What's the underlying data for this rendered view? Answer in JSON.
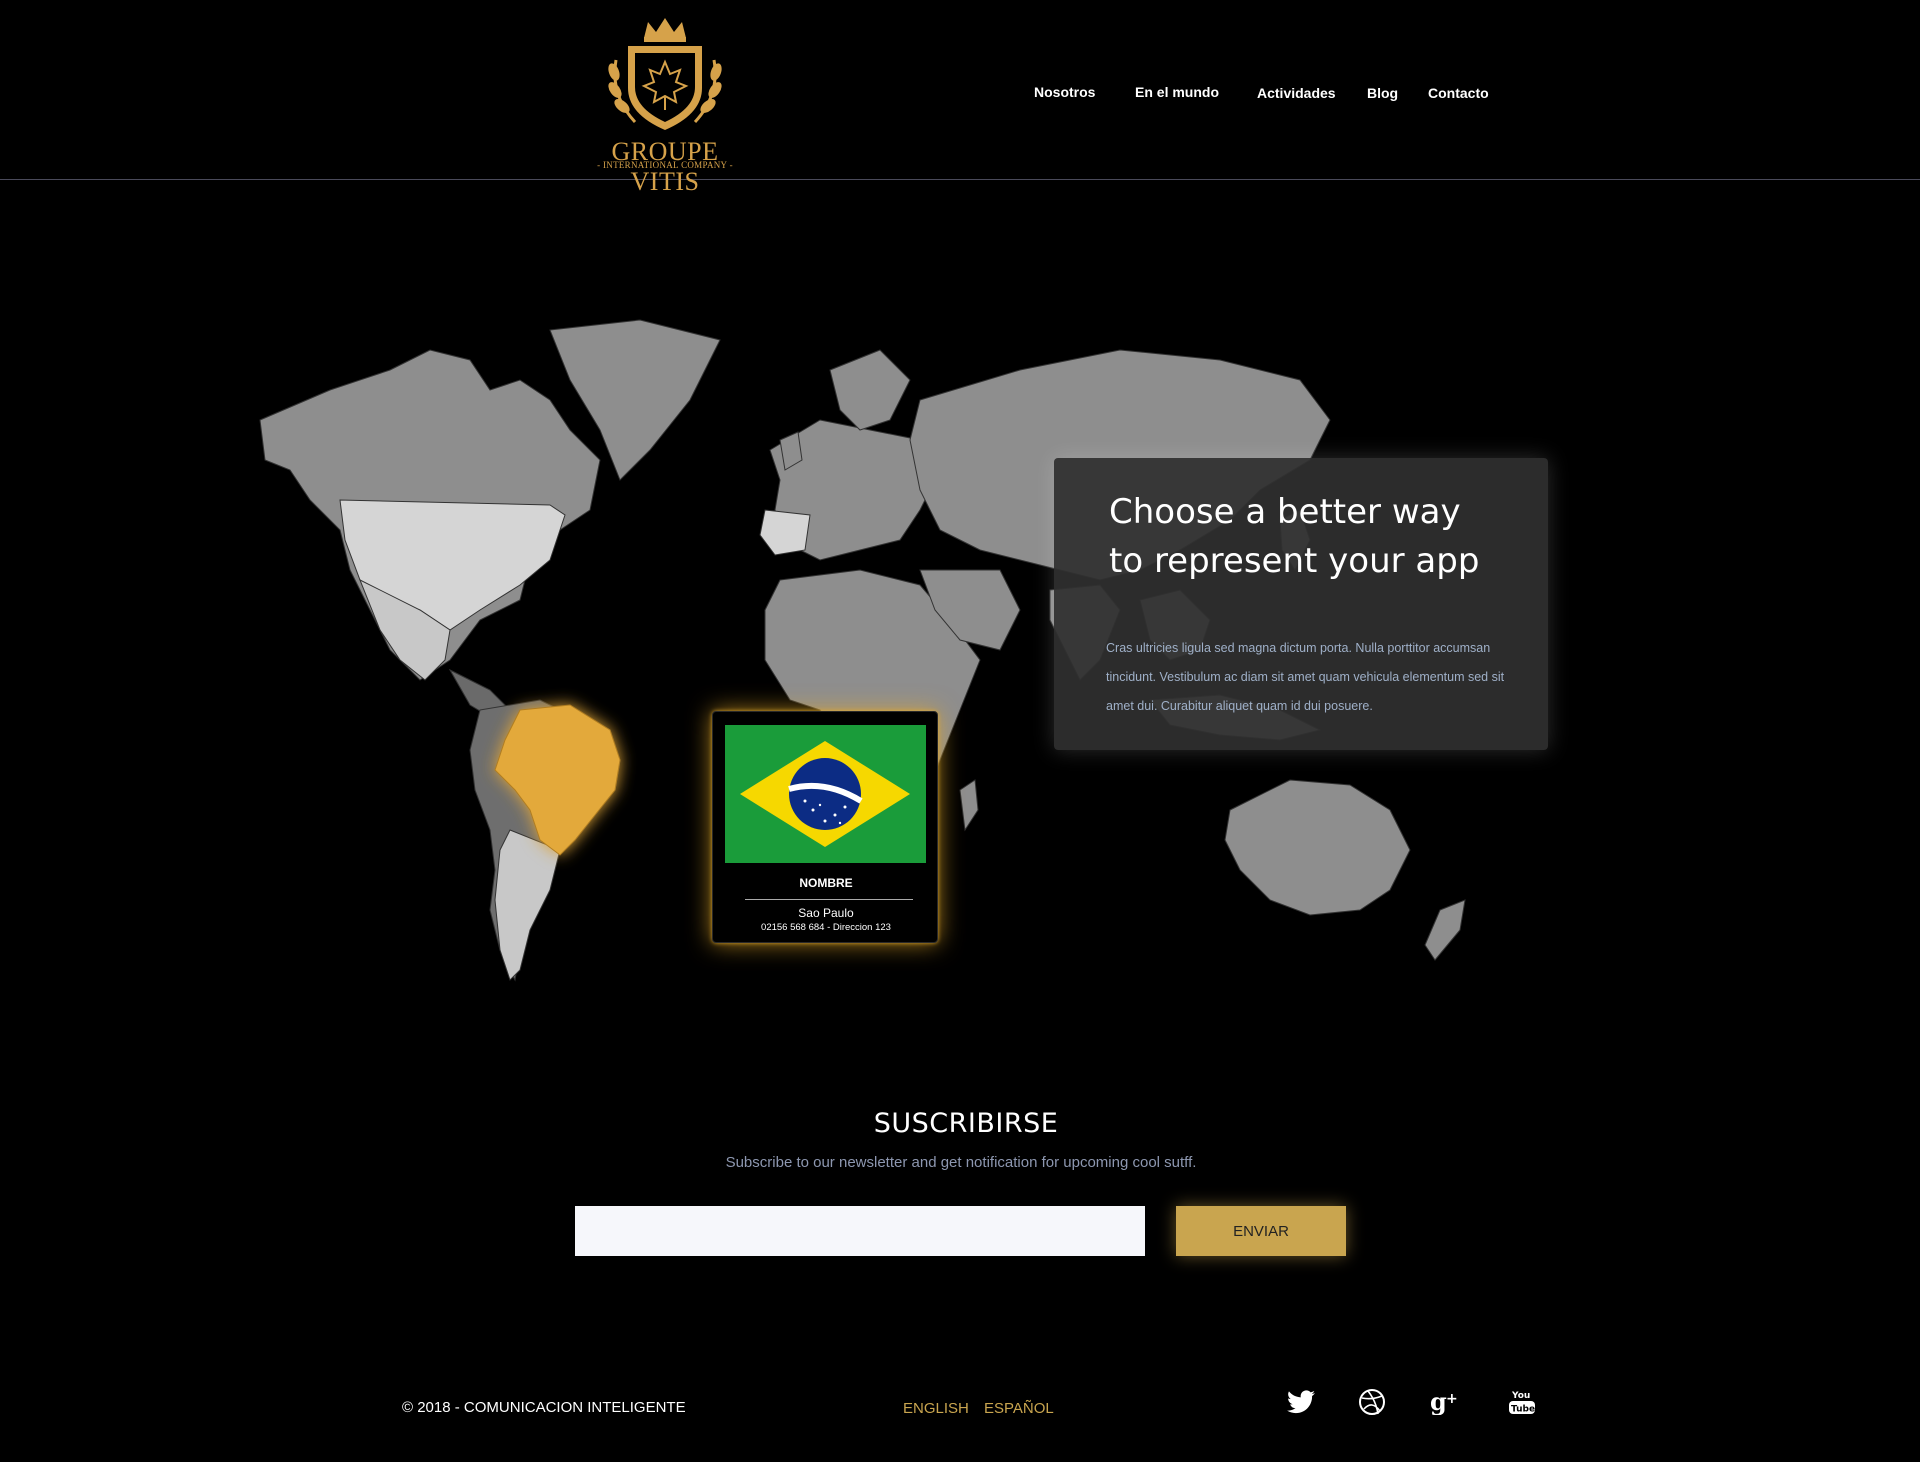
{
  "brand": {
    "name": "GROUPE VITIS",
    "tagline": "- INTERNATIONAL COMPANY -"
  },
  "nav": {
    "items": [
      {
        "label": "Nosotros"
      },
      {
        "label": "En el mundo"
      },
      {
        "label": "Actividades"
      },
      {
        "label": "Blog"
      },
      {
        "label": "Contacto"
      }
    ]
  },
  "info_card": {
    "title": "Choose a better way to represent your app",
    "body": "Cras ultricies ligula sed magna dictum porta. Nulla porttitor accumsan tincidunt. Vestibulum ac diam sit amet quam vehicula elementum sed sit amet dui. Curabitur aliquet quam id dui posuere."
  },
  "country_popup": {
    "name_label": "NOMBRE",
    "city": "Sao Paulo",
    "detail": "02156 568 684 - Direccion 123",
    "flag_icon": "brazil-flag-icon"
  },
  "subscribe": {
    "title": "SUSCRIBIRSE",
    "subtitle": "Subscribe to our newsletter and get notification for upcoming cool sutff.",
    "input_value": "",
    "button_label": "ENVIAR"
  },
  "footer": {
    "copyright": "© 2018 - COMUNICACION INTELIGENTE",
    "lang_en": "ENGLISH",
    "lang_es": "ESPAÑOL",
    "social_icons": [
      "twitter-icon",
      "dribbble-icon",
      "google-plus-icon",
      "youtube-icon"
    ]
  },
  "colors": {
    "background": "#000000",
    "accent_gold": "#c9a54f",
    "map_land": "#8a8a8a",
    "map_highlight": "#e3a93a",
    "card_bg": "#303030"
  }
}
